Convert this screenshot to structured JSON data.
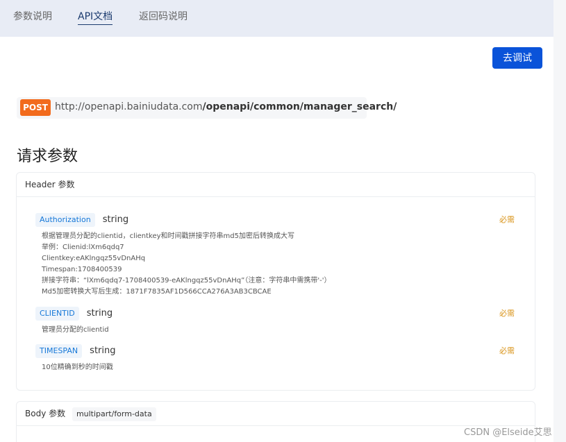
{
  "tabs": [
    {
      "label": "参数说明"
    },
    {
      "label": "API文档"
    },
    {
      "label": "返回码说明"
    }
  ],
  "try_button": "去调试",
  "endpoint": {
    "method": "POST",
    "base": "http://openapi.bainiudata.com",
    "path": "/openapi/common/manager_search/"
  },
  "section_title": "请求参数",
  "header_card": {
    "title": "Header 参数",
    "params": [
      {
        "name": "Authorization",
        "type": "string",
        "required": "必需",
        "desc": [
          "根据管理员分配的clientid，clientkey和时间戳拼接字符串md5加密后转换成大写",
          "举例：Clienid:lXm6qdq7",
          "Clientkey:eAKlngqz55vDnAHq",
          "Timespan:1708400539",
          "拼接字符串：“lXm6qdq7-1708400539-eAKlngqz55vDnAHq”（注意：字符串中需携带'-'）",
          "Md5加密转换大写后生成：1871F7835AF1D566CCA276A3AB3CBCAE"
        ]
      },
      {
        "name": "CLIENTID",
        "type": "string",
        "required": "必需",
        "desc": [
          "管理员分配的clientid"
        ]
      },
      {
        "name": "TIMESPAN",
        "type": "string",
        "required": "必需",
        "desc": [
          "10位精确到秒的时间戳"
        ]
      }
    ]
  },
  "body_card": {
    "title": "Body 参数",
    "content_type": "multipart/form-data"
  },
  "watermark": "CSDN @Elseide艾思"
}
